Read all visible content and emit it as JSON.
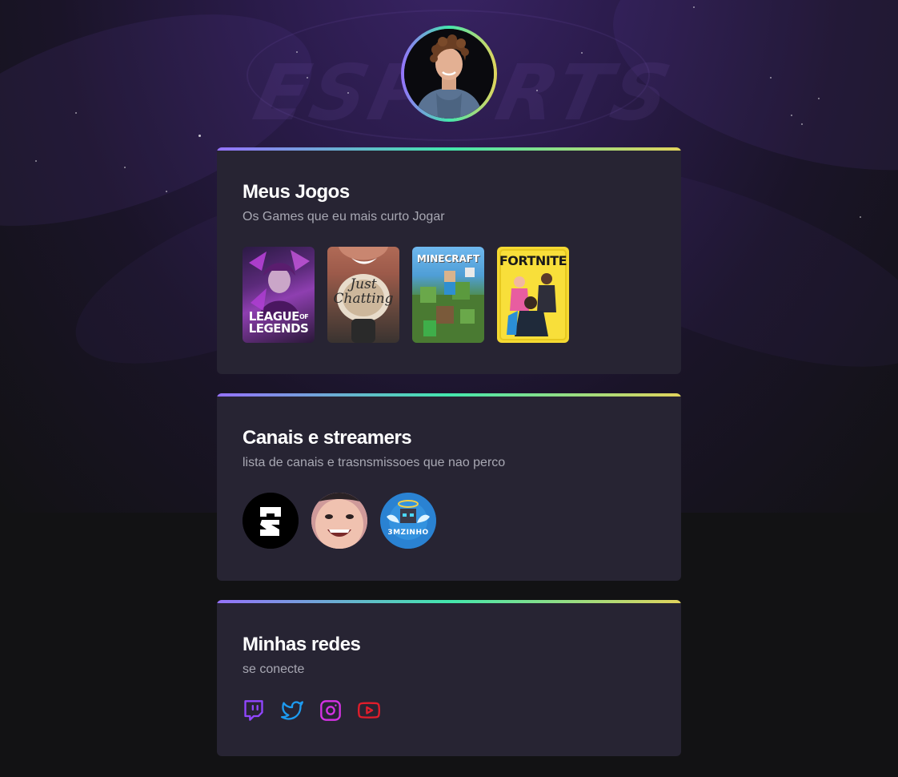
{
  "profile": {
    "avatar_alt": ""
  },
  "background": {
    "watermark": "ESPORTS"
  },
  "games_card": {
    "title": "Meus Jogos",
    "subtitle": "Os Games que eu mais curto Jogar",
    "items": [
      {
        "name": "LEAGUE OF LEGENDS",
        "line1": "LEAGUE",
        "line_of": "OF",
        "line2": "LEGENDS"
      },
      {
        "name": "Just Chatting",
        "line1": "Just",
        "line2": "Chatting"
      },
      {
        "name": "MINECRAFT",
        "line1": "MINECRAFT"
      },
      {
        "name": "FORTNITE",
        "line1": "FORTNITE"
      }
    ]
  },
  "channels_card": {
    "title": "Canais e streamers",
    "subtitle": "lista de canais e trasnsmissoes que nao perco",
    "items": [
      {
        "name": "channel-logo-white-symbol"
      },
      {
        "name": "streamer-face-portrait"
      },
      {
        "name": "streamer-mzinho",
        "label": "3MZINHO"
      }
    ]
  },
  "networks_card": {
    "title": "Minhas redes",
    "subtitle": "se conecte",
    "items": [
      {
        "name": "twitch",
        "icon": "twitch-icon",
        "color": "#9146ff"
      },
      {
        "name": "twitter",
        "icon": "twitter-icon",
        "color": "#1d9bf0"
      },
      {
        "name": "instagram",
        "icon": "instagram-icon",
        "color": "#d632e6"
      },
      {
        "name": "youtube",
        "icon": "youtube-icon",
        "color": "#e11d2b"
      }
    ]
  },
  "colors": {
    "page_background": "#121214",
    "card_background": "#272433",
    "gradient_start": "#9572fc",
    "gradient_mid": "#43e7ad",
    "gradient_end": "#e2d45c",
    "title": "#ffffff",
    "subtitle": "#a8a8b3"
  }
}
